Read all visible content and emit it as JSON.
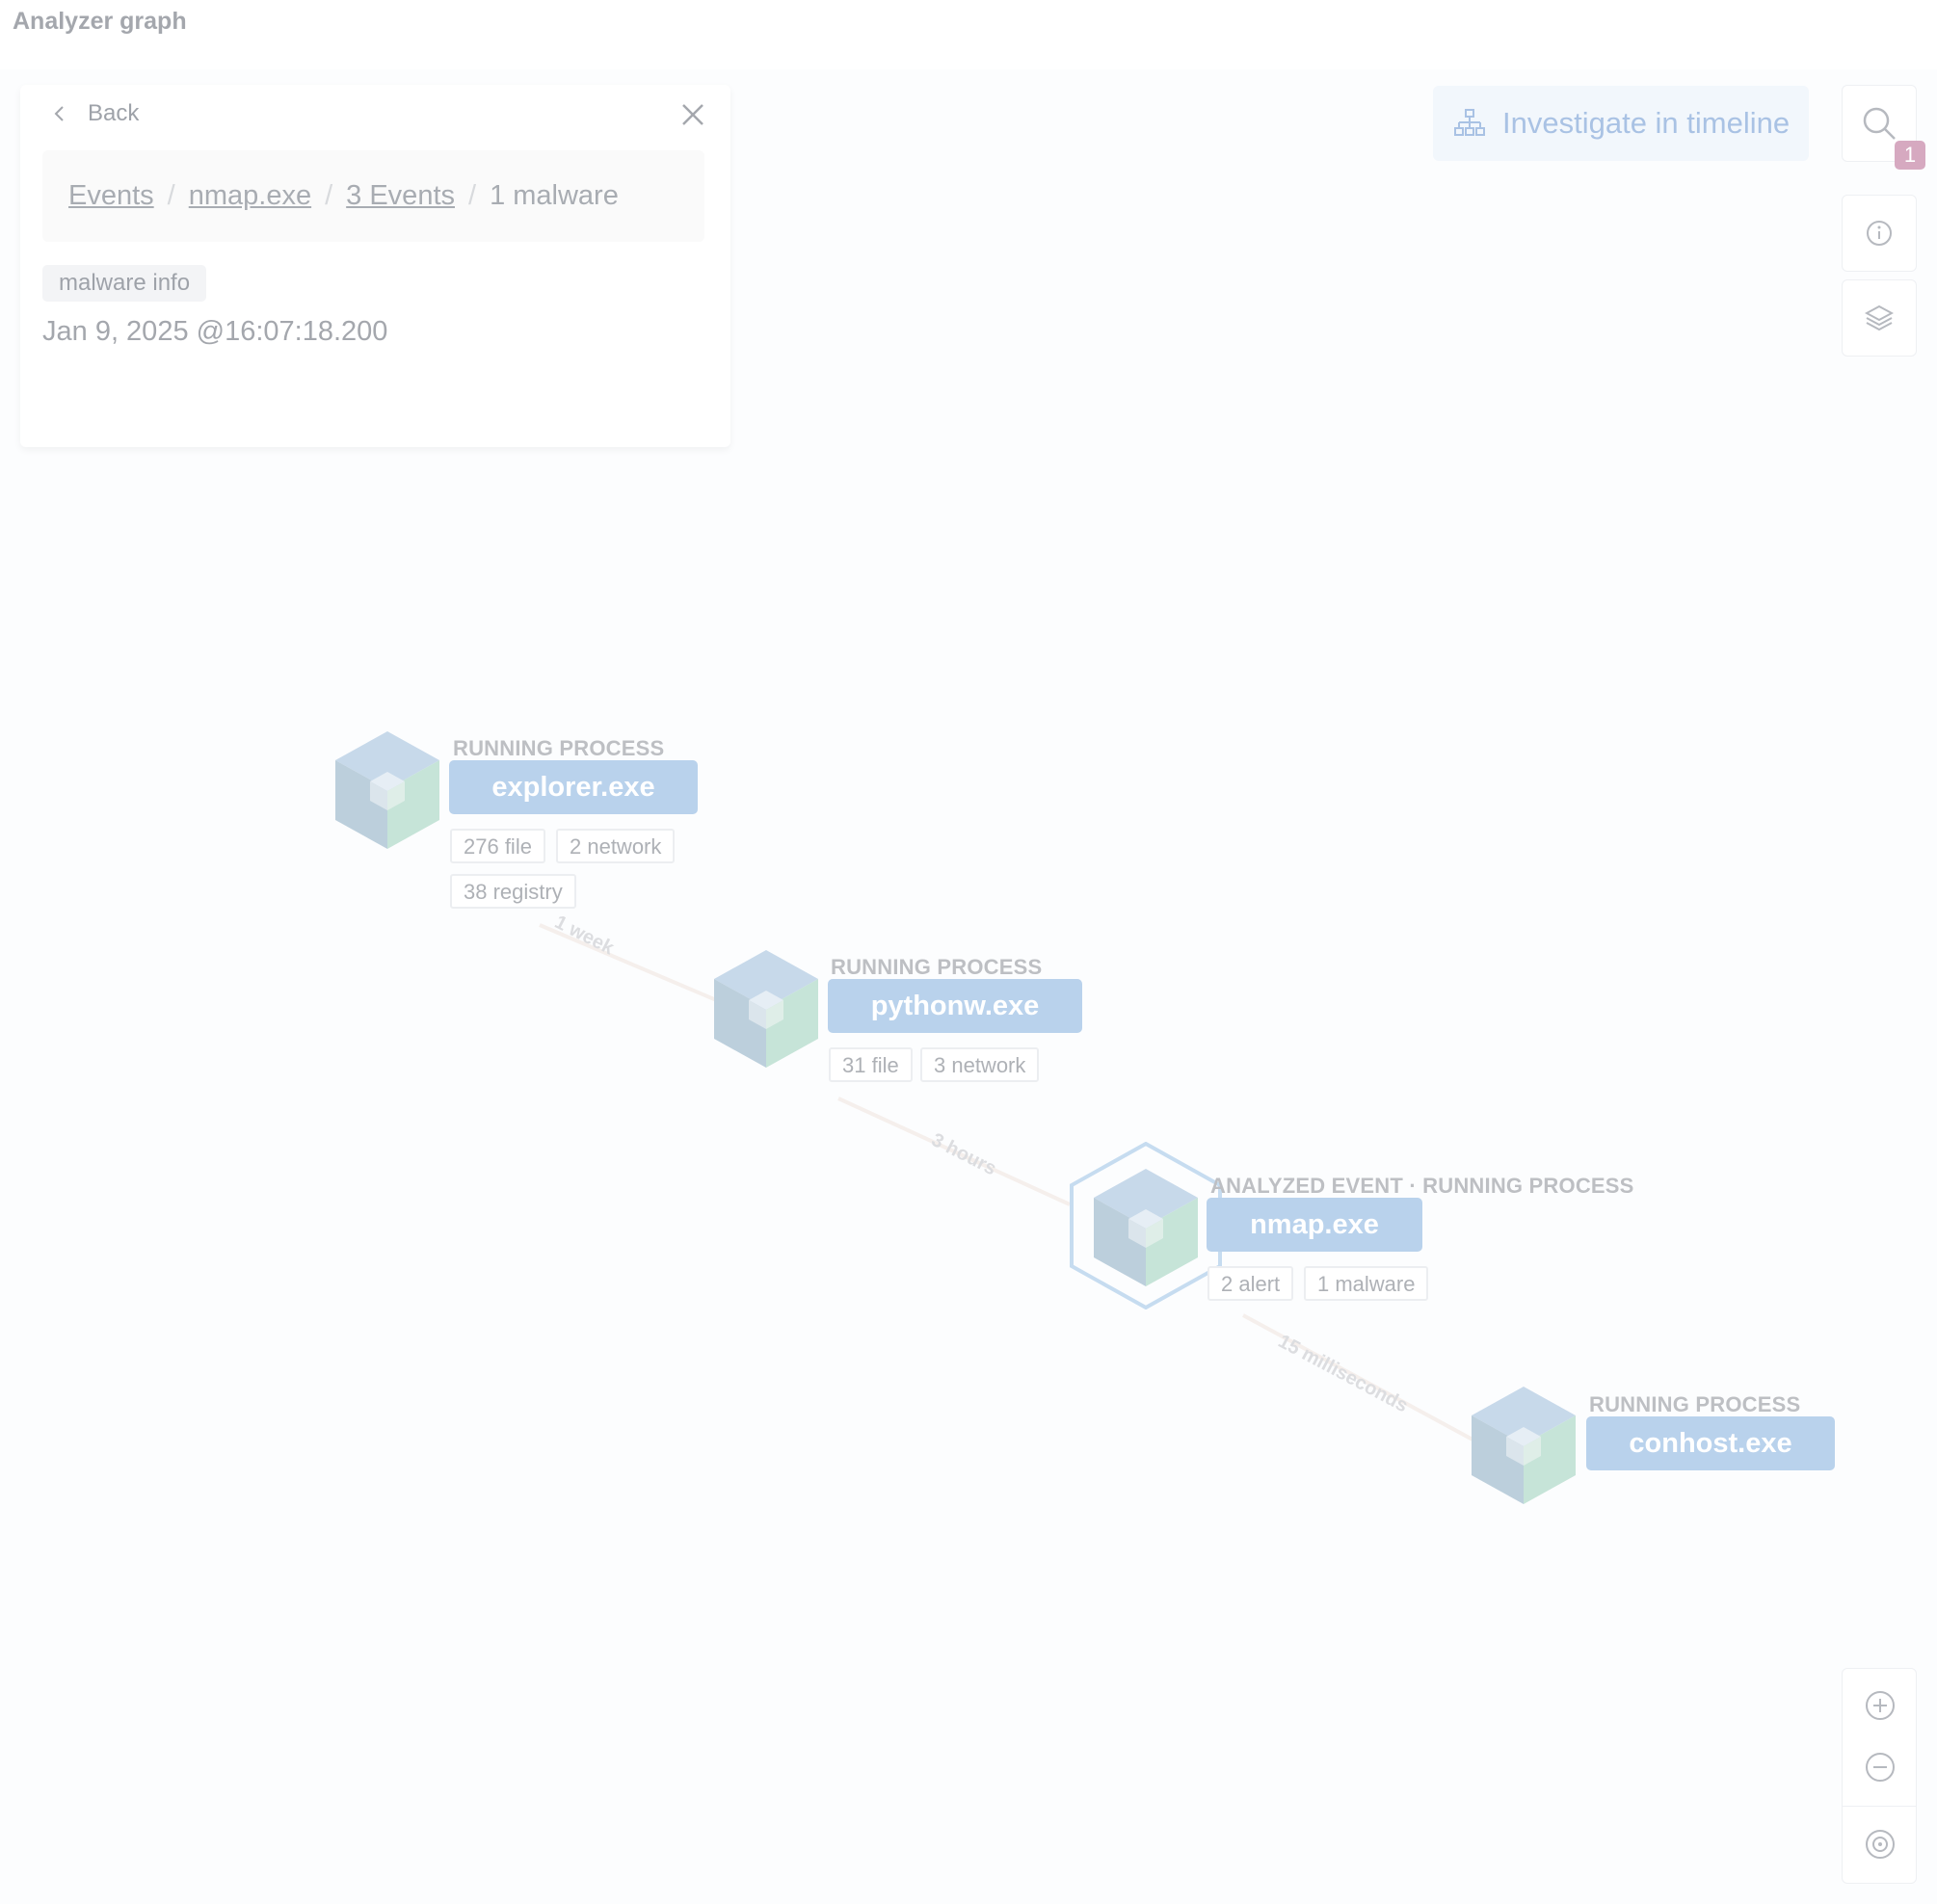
{
  "page": {
    "title": "Analyzer graph"
  },
  "panel": {
    "back_label": "Back",
    "breadcrumbs": {
      "events": "Events",
      "process": "nmap.exe",
      "count": "3 Events",
      "current": "1 malware"
    },
    "tag": "malware info",
    "timestamp": "Jan 9, 2025 @16:07:18.200"
  },
  "toolbar": {
    "investigate_label": "Investigate in timeline",
    "search_badge": "1"
  },
  "nodes": [
    {
      "type": "RUNNING PROCESS",
      "name": "explorer.exe",
      "stats": [
        "276 file",
        "2 network",
        "38 registry"
      ]
    },
    {
      "type": "RUNNING PROCESS",
      "name": "pythonw.exe",
      "stats": [
        "31 file",
        "3 network"
      ]
    },
    {
      "type": "ANALYZED EVENT · RUNNING PROCESS",
      "name": "nmap.exe",
      "stats": [
        "2 alert",
        "1 malware"
      ]
    },
    {
      "type": "RUNNING PROCESS",
      "name": "conhost.exe",
      "stats": []
    }
  ],
  "edges": [
    "1 week",
    "3 hours",
    "15 milliseconds"
  ],
  "colors": {
    "accent": "#b9d2ec",
    "badge": "#d6a9c0",
    "node_top": "#c5d8ea",
    "node_left": "#bdd0dd",
    "node_right": "#c8e6da"
  }
}
